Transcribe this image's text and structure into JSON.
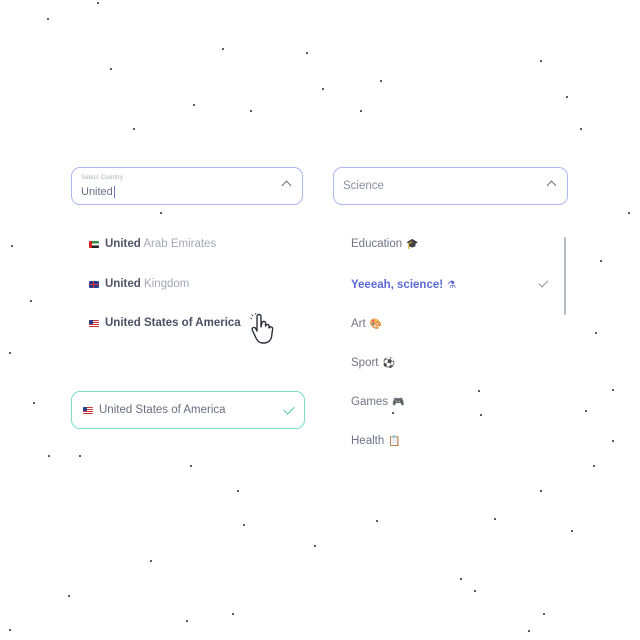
{
  "country_select": {
    "label": "Select Country",
    "value": "United"
  },
  "country_options": [
    {
      "match": "United",
      "rest": " Arab Emirates",
      "flag": "uae"
    },
    {
      "match": "United",
      "rest": " Kingdom",
      "flag": "uk"
    },
    {
      "match": "United States of America",
      "rest": "",
      "flag": "us"
    }
  ],
  "selected_country": {
    "value": "United States of America",
    "flag": "us",
    "status_color": "#4cc9a6"
  },
  "category_select": {
    "value": "Science"
  },
  "category_options": [
    {
      "label": "Education",
      "emoji": "🎓"
    },
    {
      "label": "Yeeeah, science!",
      "emoji": "⚗",
      "selected": true
    },
    {
      "label": "Art",
      "emoji": "🎨"
    },
    {
      "label": "Sport",
      "emoji": "⚽"
    },
    {
      "label": "Games",
      "emoji": "🎮"
    },
    {
      "label": "Health",
      "emoji": "📋"
    }
  ],
  "colors": {
    "accent": "#5a6bd6",
    "border": "#aeb8f0",
    "success": "#4cc9a6"
  },
  "icons": {
    "cursor": "hand-pointer-icon",
    "open_indicator": "chevron-up-icon",
    "selected_indicator": "check-icon"
  }
}
